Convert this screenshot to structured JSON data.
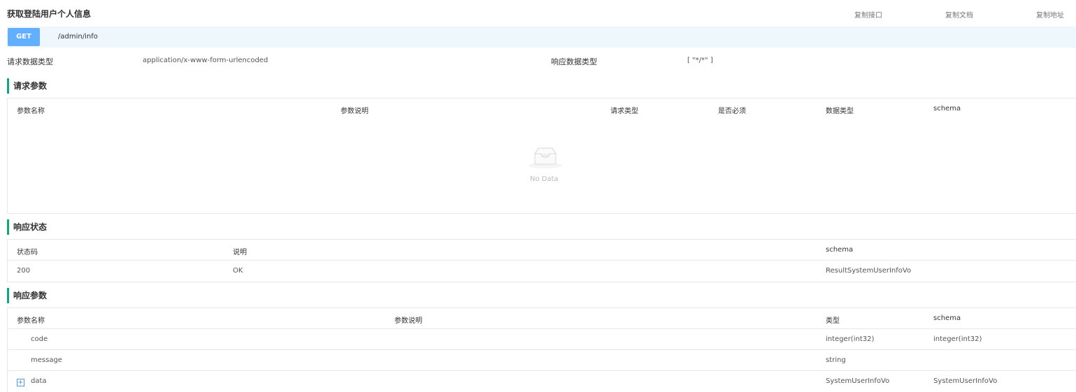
{
  "header": {
    "title": "获取登陆用户个人信息",
    "copy_interface": "复制接口",
    "copy_doc": "复制文档",
    "copy_address": "复制地址"
  },
  "request": {
    "method": "GET",
    "path": "/admin/info",
    "req_type_label": "请求数据类型",
    "req_type_value": "application/x-www-form-urlencoded",
    "resp_type_label": "响应数据类型",
    "resp_type_value": "[ \"*/*\" ]"
  },
  "request_params": {
    "title": "请求参数",
    "columns": [
      "参数名称",
      "参数说明",
      "请求类型",
      "是否必须",
      "数据类型",
      "schema"
    ],
    "empty_text": "No Data"
  },
  "response_status": {
    "title": "响应状态",
    "columns": [
      "状态码",
      "说明",
      "schema"
    ],
    "rows": [
      {
        "code": "200",
        "desc": "OK",
        "schema": "ResultSystemUserInfoVo"
      }
    ]
  },
  "response_params": {
    "title": "响应参数",
    "columns": [
      "参数名称",
      "参数说明",
      "类型",
      "schema"
    ],
    "rows": [
      {
        "name": "code",
        "desc": "",
        "type": "integer(int32)",
        "schema": "integer(int32)"
      },
      {
        "name": "message",
        "desc": "",
        "type": "string",
        "schema": ""
      },
      {
        "name": "data",
        "desc": "",
        "type": "SystemUserInfoVo",
        "schema": "SystemUserInfoVo",
        "expand": "+"
      }
    ]
  },
  "colors": {
    "accent": "#11a57b",
    "get_badge": "#61affe",
    "url_bar_bg": "#eef6fe"
  }
}
